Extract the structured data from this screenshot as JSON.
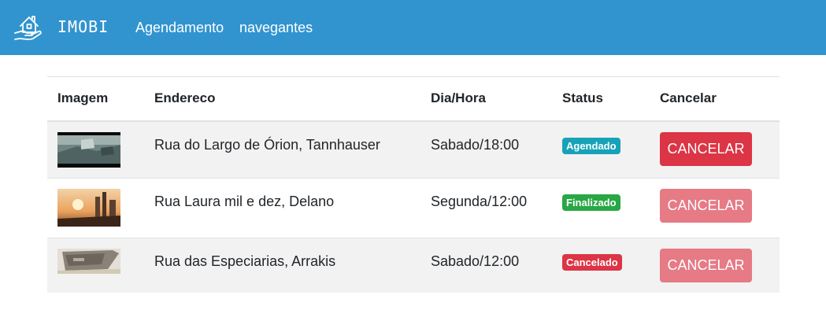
{
  "navbar": {
    "brand": "IMOBI",
    "links": [
      "Agendamento",
      "navegantes"
    ],
    "logo_icon": "house-in-hand-icon",
    "background": "#3194cf"
  },
  "table": {
    "headers": [
      "Imagem",
      "Endereco",
      "Dia/Hora",
      "Status",
      "Cancelar"
    ],
    "rows": [
      {
        "image": "snowy-landscape-thumbnail",
        "address": "Rua do Largo de Órion, Tannhauser",
        "datetime": "Sabado/18:00",
        "status": "Agendado",
        "status_color": "#17a2b8",
        "cancel_label": "CANCELAR",
        "cancel_enabled": true
      },
      {
        "image": "sunset-city-thumbnail",
        "address": "Rua Laura mil e dez, Delano",
        "datetime": "Segunda/12:00",
        "status": "Finalizado",
        "status_color": "#28a745",
        "cancel_label": "CANCELAR",
        "cancel_enabled": false
      },
      {
        "image": "desert-ship-thumbnail",
        "address": "Rua das Especiarias, Arrakis",
        "datetime": "Sabado/12:00",
        "status": "Cancelado",
        "status_color": "#dc3545",
        "cancel_label": "CANCELAR",
        "cancel_enabled": false
      }
    ]
  }
}
